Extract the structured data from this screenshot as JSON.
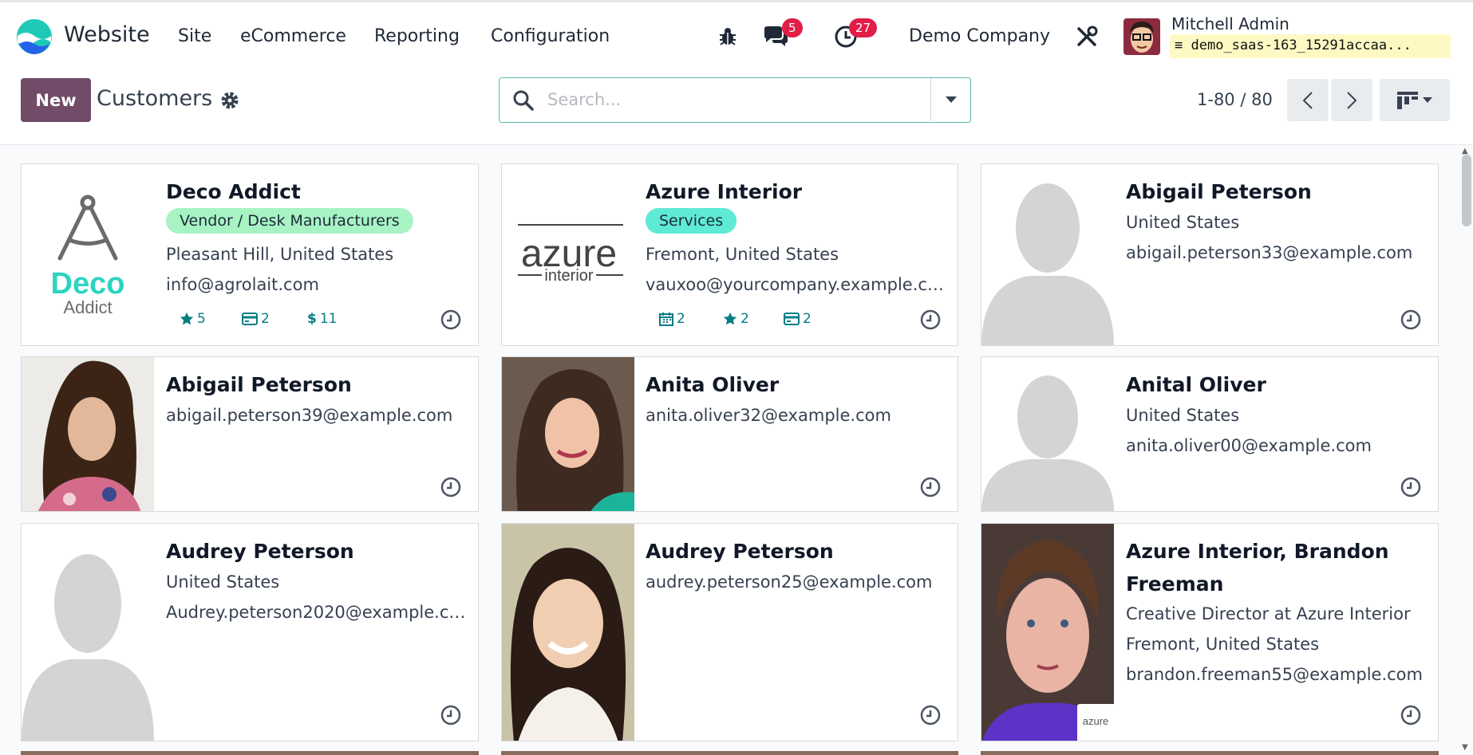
{
  "navbar": {
    "app_name": "Website",
    "menus": [
      "Site",
      "eCommerce",
      "Reporting",
      "Configuration"
    ],
    "messages_count": "5",
    "activities_count": "27",
    "company": "Demo Company",
    "user_name": "Mitchell Admin",
    "database": "demo_saas-163_15291accaa..."
  },
  "control_panel": {
    "new_label": "New",
    "title": "Customers",
    "search_placeholder": "Search...",
    "pager": "1-80 / 80"
  },
  "cards": [
    {
      "title": "Deco Addict",
      "tag": "Vendor / Desk Manufacturers",
      "location": "Pleasant Hill, United States",
      "email": "info@agrolait.com",
      "stats": {
        "opportunities": "5",
        "invoices": "2",
        "sales": "11"
      },
      "logo_text": [
        "Deco",
        "Addict"
      ]
    },
    {
      "title": "Azure Interior",
      "tag": "Services",
      "location": "Fremont, United States",
      "email": "vauxoo@yourcompany.example.com",
      "stats": {
        "meetings": "2",
        "opportunities": "2",
        "invoices": "2"
      },
      "logo_text": [
        "azure",
        "interior"
      ]
    },
    {
      "title": "Abigail Peterson",
      "location": "United States",
      "email": "abigail.peterson33@example.com"
    },
    {
      "title": "Abigail Peterson",
      "email": "abigail.peterson39@example.com"
    },
    {
      "title": "Anita Oliver",
      "email": "anita.oliver32@example.com"
    },
    {
      "title": "Anital Oliver",
      "location": "United States",
      "email": "anita.oliver00@example.com"
    },
    {
      "title": "Audrey Peterson",
      "location": "United States",
      "email": "Audrey.peterson2020@example.com"
    },
    {
      "title": "Audrey Peterson",
      "email": "audrey.peterson25@example.com"
    },
    {
      "title": "Azure Interior, Brandon Freeman",
      "function": "Creative Director at Azure Interior",
      "location": "Fremont, United States",
      "email": "brandon.freeman55@example.com",
      "company_logo": "azure"
    }
  ],
  "colors": {
    "brand": "#714b67",
    "tag_vendor": "#a7f3c4",
    "tag_services": "#5eead4",
    "badge": "#e11d48",
    "stat": "#017e84",
    "accent": "#5fb7b1"
  }
}
